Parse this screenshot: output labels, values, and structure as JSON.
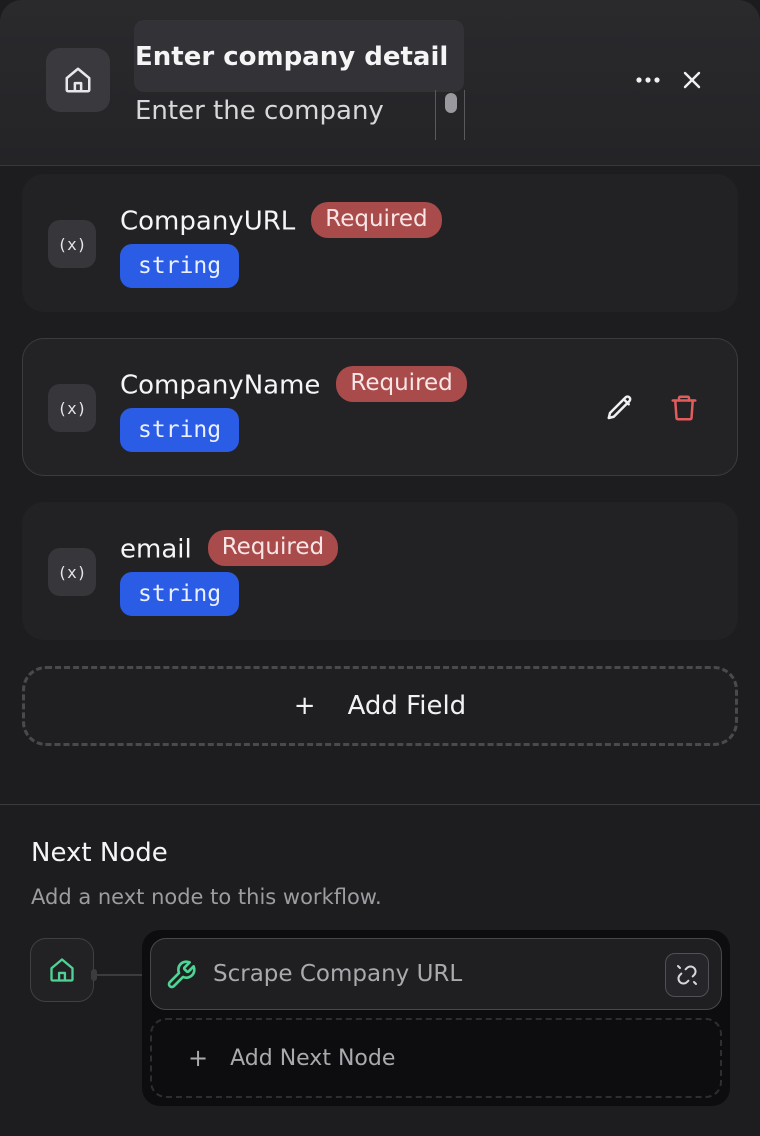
{
  "header": {
    "title_value": "Enter company detail",
    "description_value": "Enter the company",
    "icons": {
      "home": "home-icon",
      "more": "more-horizontal-icon",
      "close": "close-icon"
    }
  },
  "fields": [
    {
      "name": "CompanyURL",
      "badge": "Required",
      "type": "string"
    },
    {
      "name": "CompanyName",
      "badge": "Required",
      "type": "string"
    },
    {
      "name": "email",
      "badge": "Required",
      "type": "string"
    }
  ],
  "variable_icon_text": "(x)",
  "add_field": {
    "plus": "+",
    "label": "Add Field"
  },
  "next_node": {
    "title": "Next Node",
    "subtitle": "Add a next node to this workflow.",
    "node_label": "Scrape Company URL",
    "add_plus": "+",
    "add_label": "Add Next Node"
  },
  "colors": {
    "required_badge": "#a94b4b",
    "type_badge": "#2b5ce6",
    "accent_green": "#4fd394",
    "delete_red": "#e25c5c"
  }
}
